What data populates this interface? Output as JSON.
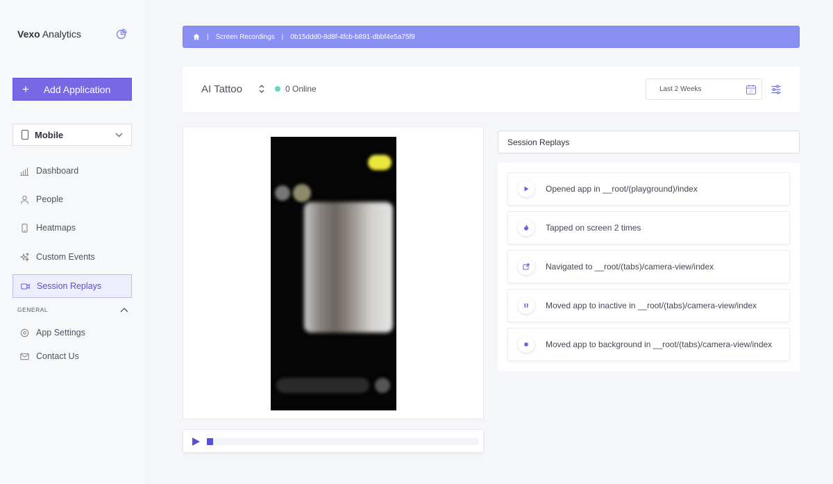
{
  "sidebar": {
    "brand_bold": "Vexo",
    "brand_rest": " Analytics",
    "add_button": "Add Application",
    "platform": "Mobile",
    "items": [
      {
        "label": "Dashboard",
        "icon": "bar-chart-icon"
      },
      {
        "label": "People",
        "icon": "user-icon"
      },
      {
        "label": "Heatmaps",
        "icon": "phone-icon"
      },
      {
        "label": "Custom Events",
        "icon": "sparkles-icon"
      },
      {
        "label": "Session Replays",
        "icon": "video-icon",
        "active": true
      }
    ],
    "general_label": "GENERAL",
    "general_items": [
      {
        "label": "App Settings",
        "icon": "gear-icon"
      },
      {
        "label": "Contact Us",
        "icon": "mail-icon"
      }
    ]
  },
  "breadcrumb": {
    "home_icon": "home-icon",
    "section": "Screen Recordings",
    "session_id": "0b15ddd0-8d8f-4fcb-b891-dbbf4e5a75f9"
  },
  "appbar": {
    "app_name": "AI Tattoo",
    "online": "0 Online",
    "date_range": "Last 2 Weeks"
  },
  "player": {
    "progress": 0.02
  },
  "replays": {
    "header": "Session Replays",
    "events": [
      {
        "text": "Opened app in __root/(playground)/index",
        "icon": "play-icon"
      },
      {
        "text": "Tapped on screen 2 times",
        "icon": "tap-icon"
      },
      {
        "text": "Navigated to __root/(tabs)/camera-view/index",
        "icon": "navigate-icon"
      },
      {
        "text": "Moved app to inactive in __root/(tabs)/camera-view/index",
        "icon": "pause-icon"
      },
      {
        "text": "Moved app to background in __root/(tabs)/camera-view/index",
        "icon": "stop-icon"
      }
    ]
  },
  "colors": {
    "accent": "#7868e6",
    "breadcrumb_bg": "#8a8ff2",
    "online": "#5fd6c9",
    "icon_purple": "#6b5fe0"
  }
}
